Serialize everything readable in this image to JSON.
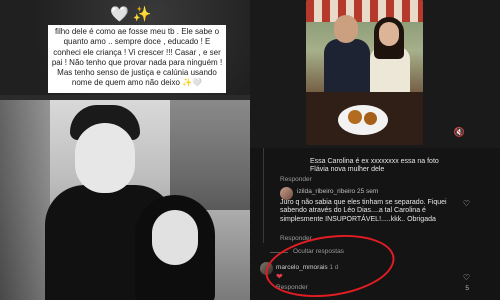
{
  "story": {
    "emojis": "🤍✨",
    "text": "filho dele é como ae fosse meu tb . Ele sabe o quanto amo .. sempre doce , educado ! E conheci ele criança ! Vi crescer !!! Casar , e ser pai ! Não tenho que provar nada para ninguém ! Mas tenho senso de justiça e calúnia usando nome de quem amo não deixo ✨🤍"
  },
  "comments": {
    "c1_text": "Essa Carolina é ex xxxxxxxx essa na foto Flávia nova mulher dele",
    "c1_reply": "Responder",
    "c2_user": "izilda_ribeiro_ribeiro",
    "c2_time": "25 sem",
    "c2_text": "Juro q não sabia que eles tinham se separado. Fiquei sabendo através do Léo Dias....a tal Carolina é simplesmente INSUPORTÁVEL!.....kkk.. Obrigada",
    "c2_reply": "Responder",
    "hide_replies": "Ocultar respostas",
    "c3_user": "marcelo_mmorais",
    "c3_time": "1 d",
    "c3_heart": "❤",
    "c3_reply": "Responder",
    "c3_likes": "5"
  },
  "icons": {
    "heart_outline": "♡",
    "sound": "🔇"
  },
  "colors": {
    "annotation_red": "#e11d24",
    "heart_red": "#e23b4a"
  }
}
